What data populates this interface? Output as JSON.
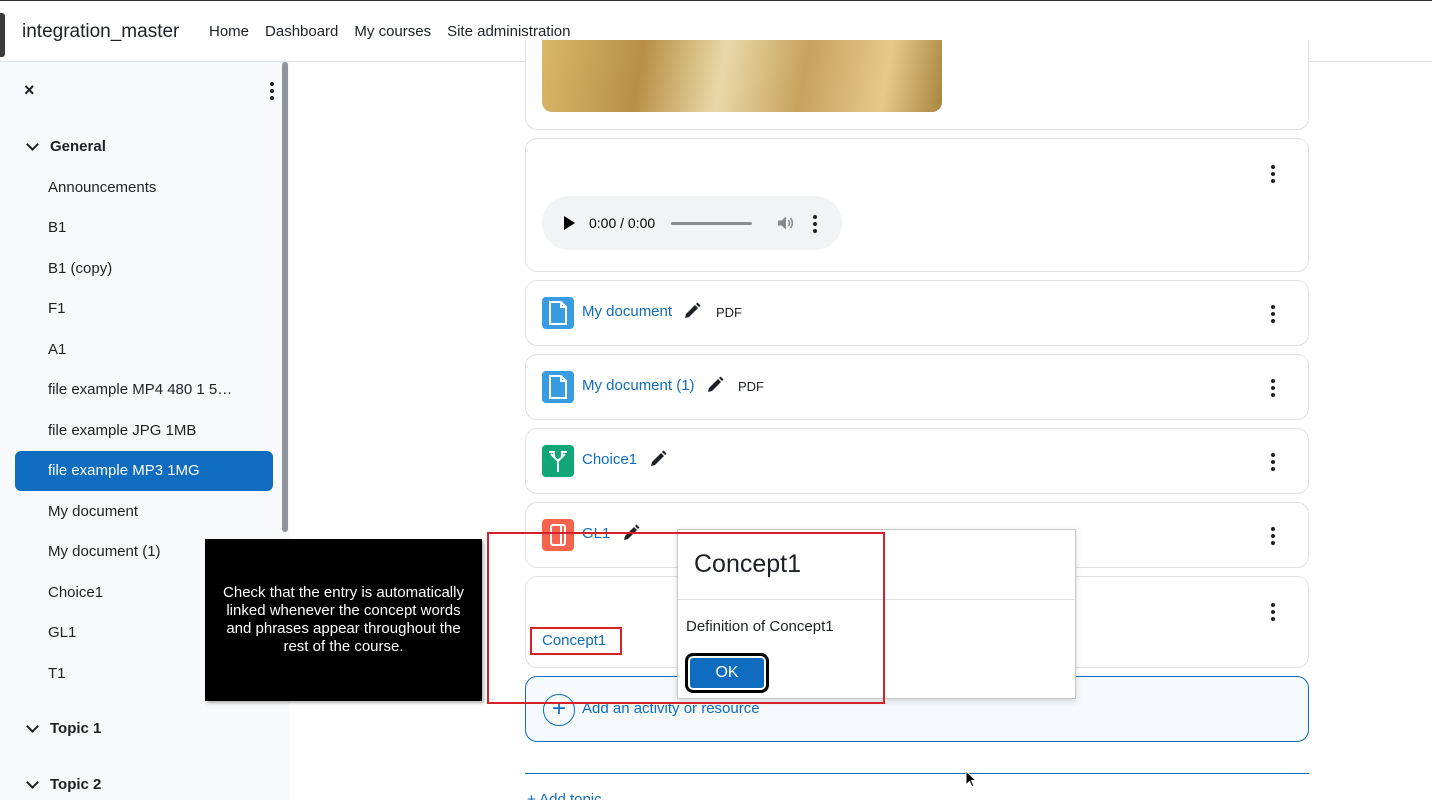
{
  "header": {
    "site_name": "integration_master",
    "nav": [
      "Home",
      "Dashboard",
      "My courses",
      "Site administration"
    ]
  },
  "drawer": {
    "close_icon": "×",
    "sections": [
      {
        "title": "General"
      },
      {
        "title": "Topic 1"
      },
      {
        "title": "Topic 2"
      }
    ],
    "items": [
      {
        "label": "Announcements"
      },
      {
        "label": "B1"
      },
      {
        "label": "B1 (copy)"
      },
      {
        "label": "F1"
      },
      {
        "label": "A1"
      },
      {
        "label": "file example MP4 480 1 5…"
      },
      {
        "label": "file example JPG 1MB"
      },
      {
        "label": "file example MP3 1MG",
        "active": true
      },
      {
        "label": "My document"
      },
      {
        "label": "My document (1)"
      },
      {
        "label": "Choice1"
      },
      {
        "label": "GL1"
      },
      {
        "label": "T1"
      }
    ]
  },
  "audio": {
    "time": "0:00 / 0:00"
  },
  "activities": [
    {
      "name": "My document",
      "badge": "PDF",
      "icon": "file-icon",
      "color": "#399be2"
    },
    {
      "name": "My document (1)",
      "badge": "PDF",
      "icon": "file-icon",
      "color": "#399be2"
    },
    {
      "name": "Choice1",
      "badge": "",
      "icon": "choice-icon",
      "color": "#11a676"
    },
    {
      "name": "GL1",
      "badge": "",
      "icon": "glossary-icon",
      "color": "#f7634d"
    }
  ],
  "concept": {
    "link": "Concept1"
  },
  "add_activity": {
    "label": "Add an activity or resource"
  },
  "add_topic": {
    "label": "+ Add topic"
  },
  "dialog": {
    "title": "Concept1",
    "body": "Definition of Concept1",
    "ok": "OK"
  },
  "callout": {
    "text": "Check that the entry is automatically linked whenever the concept words and phrases appear throughout the rest of the course."
  },
  "colors": {
    "primary": "#0f6cbf",
    "annotation_red": "#d3222a"
  }
}
